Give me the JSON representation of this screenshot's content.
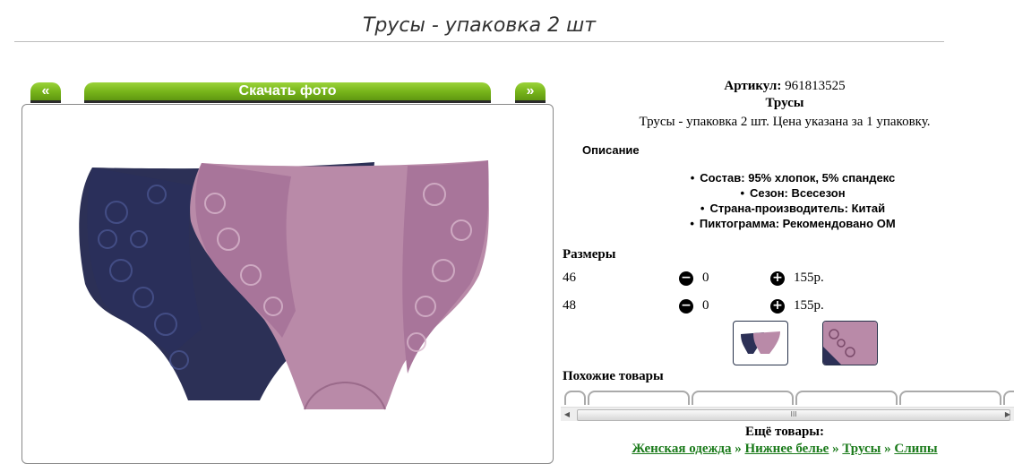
{
  "page_title": "Трусы - упаковка 2 шт",
  "gallery": {
    "prev_label": "«",
    "download_label": "Скачать фото",
    "next_label": "»"
  },
  "product": {
    "article_label": "Артикул:",
    "article_value": "961813525",
    "name": "Трусы",
    "description": "Трусы - упаковка 2 шт. Цена указана за 1 упаковку.",
    "desc_title": "Описание",
    "desc_items": [
      "Состав: 95% хлопок, 5% спандекс",
      "Сезон: Всесезон",
      "Страна-производитель: Китай",
      "Пиктограмма: Рекомендовано ОМ"
    ]
  },
  "sizes": {
    "title": "Размеры",
    "rows": [
      {
        "size": "46",
        "qty": "0",
        "price": "155р."
      },
      {
        "size": "48",
        "qty": "0",
        "price": "155р."
      }
    ]
  },
  "icons": {
    "minus": "minus-circle-icon",
    "plus": "plus-circle-icon"
  },
  "similar": {
    "title": "Похожие товары",
    "scroll_grip": "III"
  },
  "more": {
    "title": "Ещё товары:",
    "crumbs": [
      "Женская одежда",
      "Нижнее белье",
      "Трусы",
      "Слипы"
    ],
    "separator": "»"
  },
  "colors": {
    "accent_green": "#78b51b",
    "link_green": "#1a7a1a",
    "navy": "#2c3056",
    "lilac": "#b98aa8"
  }
}
